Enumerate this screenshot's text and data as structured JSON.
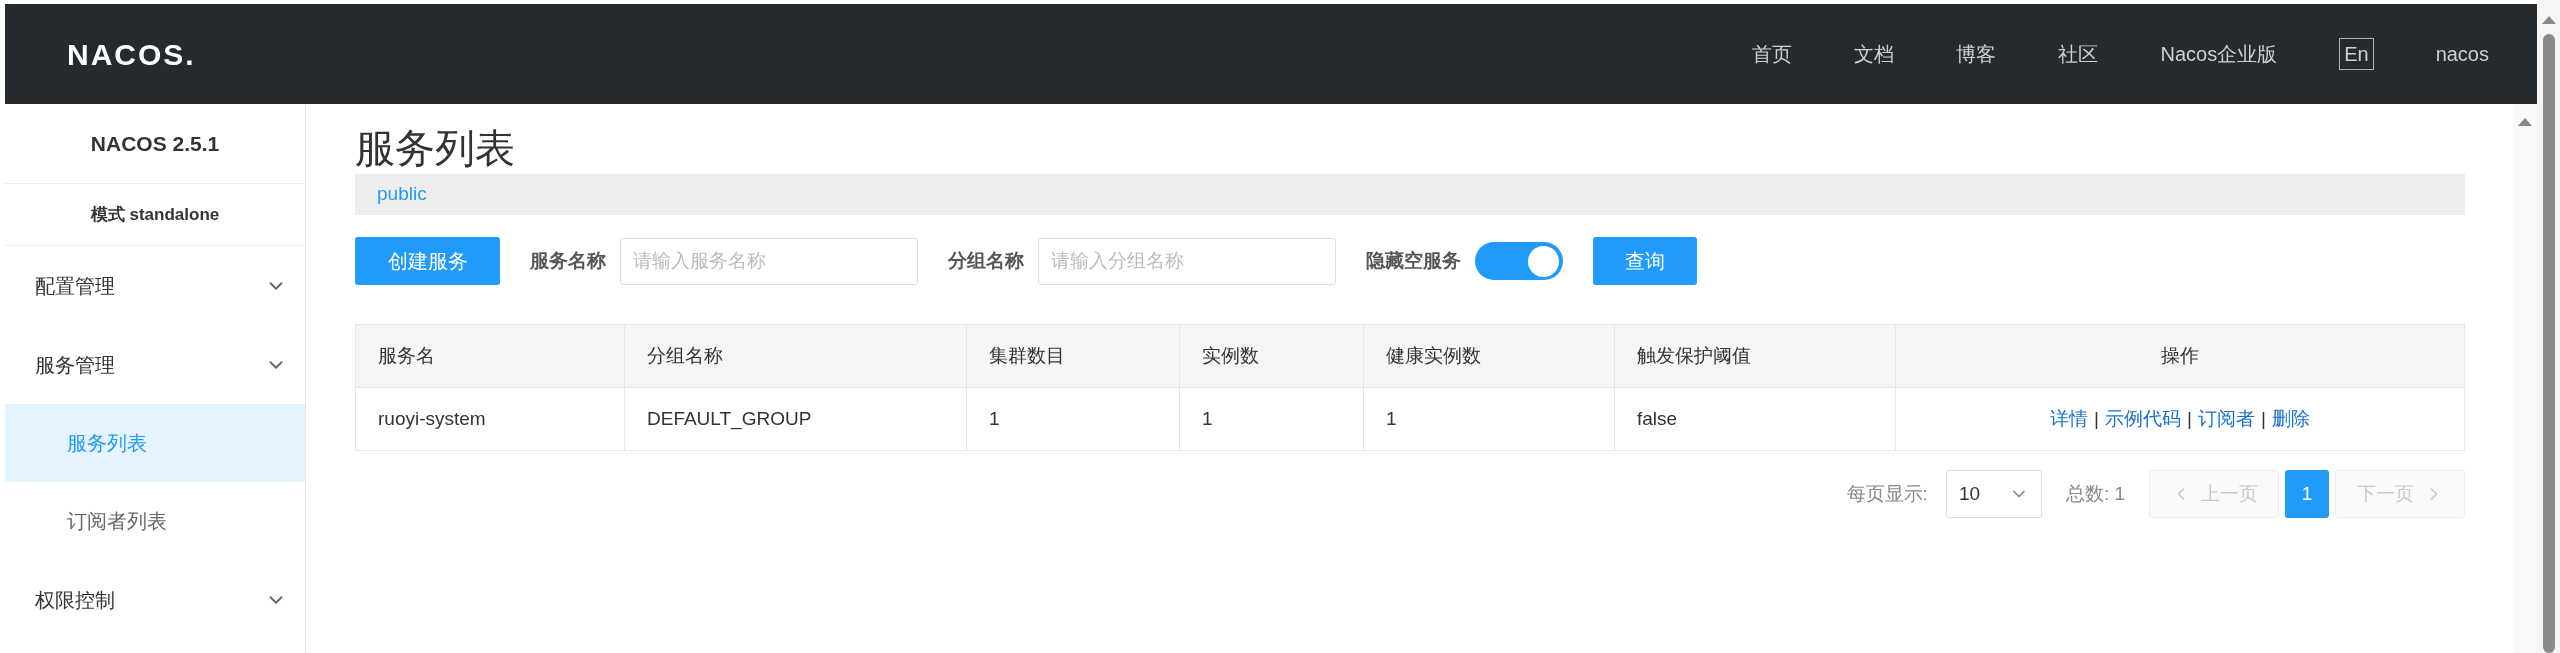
{
  "header": {
    "logo": "NACOS.",
    "nav": [
      {
        "label": "首页",
        "kind": "link"
      },
      {
        "label": "文档",
        "kind": "link"
      },
      {
        "label": "博客",
        "kind": "link"
      },
      {
        "label": "社区",
        "kind": "link"
      },
      {
        "label": "Nacos企业版",
        "kind": "link"
      },
      {
        "label": "En",
        "kind": "lang"
      },
      {
        "label": "nacos",
        "kind": "link"
      }
    ]
  },
  "sidebar": {
    "title": "NACOS 2.5.1",
    "mode": "模式 standalone",
    "items": [
      {
        "label": "配置管理"
      },
      {
        "label": "服务管理",
        "children": [
          {
            "label": "服务列表",
            "selected": true
          },
          {
            "label": "订阅者列表",
            "selected": false
          }
        ]
      },
      {
        "label": "权限控制"
      }
    ]
  },
  "page": {
    "title": "服务列表",
    "namespace": "public"
  },
  "toolbar": {
    "create_button": "创建服务",
    "service_name": {
      "label": "服务名称",
      "placeholder": "请输入服务名称"
    },
    "group_name": {
      "label": "分组名称",
      "placeholder": "请输入分组名称"
    },
    "hide_empty": {
      "label": "隐藏空服务",
      "on": true
    },
    "query_button": "查询"
  },
  "table": {
    "columns": [
      "服务名",
      "分组名称",
      "集群数目",
      "实例数",
      "健康实例数",
      "触发保护阈值",
      "操作"
    ],
    "rows": [
      {
        "cells": [
          "ruoyi-system",
          "DEFAULT_GROUP",
          "1",
          "1",
          "1",
          "false"
        ],
        "actions": [
          "详情",
          "示例代码",
          "订阅者",
          "删除"
        ],
        "separator": "|"
      }
    ]
  },
  "pagination": {
    "page_size_label": "每页显示:",
    "page_size": "10",
    "total": "总数: 1",
    "prev": "上一页",
    "next": "下一页",
    "pages": [
      {
        "label": "1",
        "selected": true
      }
    ]
  }
}
